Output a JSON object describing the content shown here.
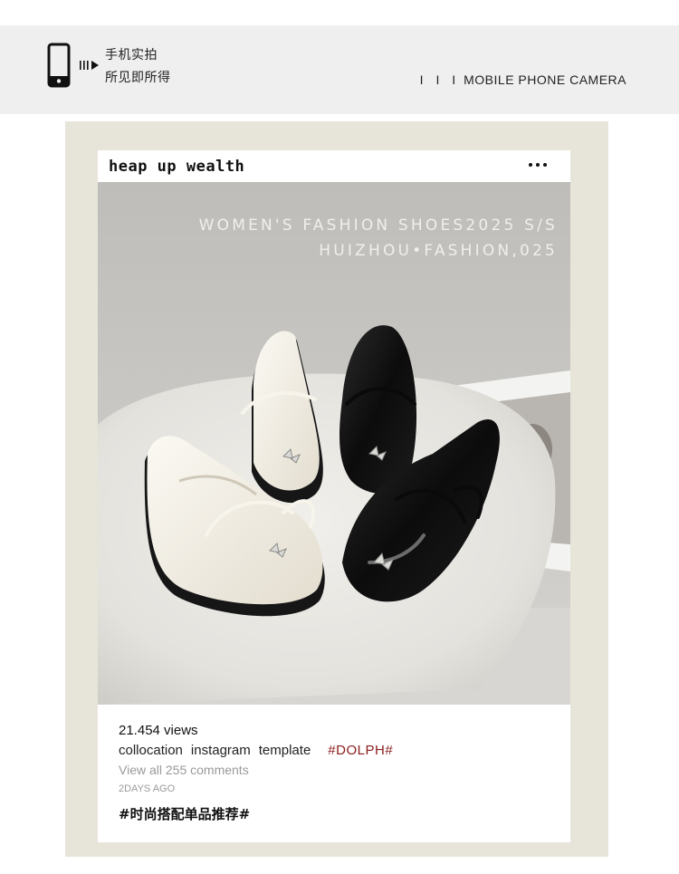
{
  "banner": {
    "line1": "手机实拍",
    "line2": "所见即所得",
    "right_bars": "I I I",
    "right_text": "MOBILE PHONE CAMERA",
    "icons": [
      "phone-icon",
      "play-icon"
    ]
  },
  "post": {
    "account": "heap up wealth",
    "more_icon": "more-icon",
    "overlay_line1": "WOMEN'S FASHION SHOES2025 S/S",
    "overlay_line2": "HUIZHOU•FASHION,025",
    "views": "21.454 views",
    "tags": [
      "collocation",
      "instagram",
      "template"
    ],
    "hashtag": "#DOLPH#",
    "comments": "View all 255 comments",
    "date": "2DAYS AGO",
    "cn_tag": "#时尚搭配单品推荐#"
  },
  "colors": {
    "banner_bg": "#efefef",
    "frame_bg": "#e7e5da",
    "hashtag": "#8c1b1b"
  }
}
